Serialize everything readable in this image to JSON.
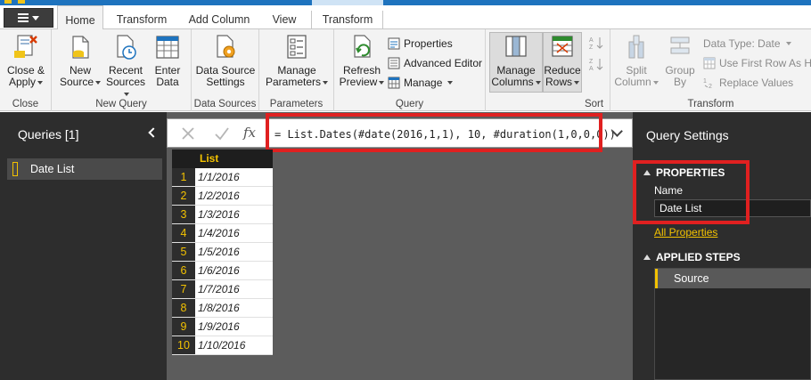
{
  "ribbon_tabs": {
    "home": "Home",
    "transform": "Transform",
    "add_column": "Add Column",
    "view": "View",
    "context_transform": "Transform"
  },
  "ribbon": {
    "close": {
      "close_apply": "Close &",
      "close_apply2": "Apply",
      "label": "Close"
    },
    "new_query": {
      "new_source": "New",
      "new_source2": "Source",
      "recent_sources": "Recent",
      "recent_sources2": "Sources",
      "enter_data": "Enter",
      "enter_data2": "Data",
      "label": "New Query"
    },
    "data_sources": {
      "settings": "Data Source",
      "settings2": "Settings",
      "label": "Data Sources"
    },
    "parameters": {
      "manage": "Manage",
      "manage2": "Parameters",
      "label": "Parameters"
    },
    "query": {
      "refresh": "Refresh",
      "refresh2": "Preview",
      "properties": "Properties",
      "advanced_editor": "Advanced Editor",
      "manage": "Manage",
      "label": "Query"
    },
    "manage_columns": {
      "line1": "Manage",
      "line2": "Columns"
    },
    "reduce_rows": {
      "line1": "Reduce",
      "line2": "Rows"
    },
    "sort": {
      "label": "Sort"
    },
    "transform": {
      "split": "Split",
      "split2": "Column",
      "group": "Group",
      "group2": "By",
      "data_type": "Data Type: Date",
      "first_row": "Use First Row As He",
      "replace": "Replace Values",
      "label": "Transform"
    }
  },
  "queries_pane": {
    "title": "Queries [1]",
    "items": [
      {
        "label": "Date List"
      }
    ]
  },
  "formula_bar": {
    "fx": "fx",
    "formula": "= List.Dates(#date(2016,1,1), 10, #duration(1,0,0,0))"
  },
  "grid": {
    "column": "List",
    "rows": [
      {
        "n": "1",
        "v": "1/1/2016"
      },
      {
        "n": "2",
        "v": "1/2/2016"
      },
      {
        "n": "3",
        "v": "1/3/2016"
      },
      {
        "n": "4",
        "v": "1/4/2016"
      },
      {
        "n": "5",
        "v": "1/5/2016"
      },
      {
        "n": "6",
        "v": "1/6/2016"
      },
      {
        "n": "7",
        "v": "1/7/2016"
      },
      {
        "n": "8",
        "v": "1/8/2016"
      },
      {
        "n": "9",
        "v": "1/9/2016"
      },
      {
        "n": "10",
        "v": "1/10/2016"
      }
    ]
  },
  "settings_pane": {
    "title": "Query Settings",
    "properties_header": "PROPERTIES",
    "name_label": "Name",
    "name_value": "Date List",
    "all_properties": "All Properties",
    "applied_steps_header": "APPLIED STEPS",
    "steps": [
      {
        "label": "Source"
      }
    ]
  },
  "colors": {
    "accent_yellow": "#f3c200",
    "highlight_red": "#e02020",
    "pane_dark": "#2d2d2d"
  }
}
